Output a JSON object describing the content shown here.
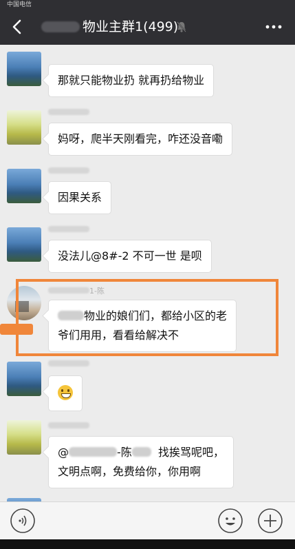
{
  "status_bar": {
    "carrier": "中国电信"
  },
  "header": {
    "title_visible": "物业主群1",
    "member_count": "(499)",
    "icons": [
      "back-arrow-icon",
      "mute-bell-icon",
      "more-icon"
    ]
  },
  "messages": [
    {
      "avatar": "landscape-avatar-a",
      "nickname": "",
      "text": "那就只能物业扔 就再扔给物业"
    },
    {
      "avatar": "landscape-avatar-b",
      "nickname": "",
      "text": "妈呀，爬半天刚看完，咋还没音嘞"
    },
    {
      "avatar": "landscape-avatar-a",
      "nickname": "",
      "text": "因果关系"
    },
    {
      "avatar": "landscape-avatar-a",
      "nickname": "",
      "text": "没法儿@8#-2 不可一世  是呗"
    },
    {
      "avatar": "landscape-avatar-c",
      "nickname": "1-陈",
      "line1": "物业的娘们们，都给小区的老",
      "line2": "爷们用用，看看给解决不"
    },
    {
      "avatar": "landscape-avatar-a",
      "nickname": "",
      "emoji": "grinning-face-emoji"
    },
    {
      "avatar": "landscape-avatar-b",
      "nickname": "",
      "line1_prefix": "@",
      "line1_mid": "-陈",
      "line1_suffix": "找挨骂呢吧，",
      "line2": "文明点啊，免费给你，你用啊"
    }
  ],
  "highlight": {
    "color": "#f0863a"
  },
  "input_bar": {
    "icons": [
      "voice-icon",
      "emoji-icon",
      "plus-icon"
    ]
  },
  "colors": {
    "header_bg": "#2f2f33",
    "chat_bg": "#ececec",
    "bubble_bg": "#ffffff"
  }
}
